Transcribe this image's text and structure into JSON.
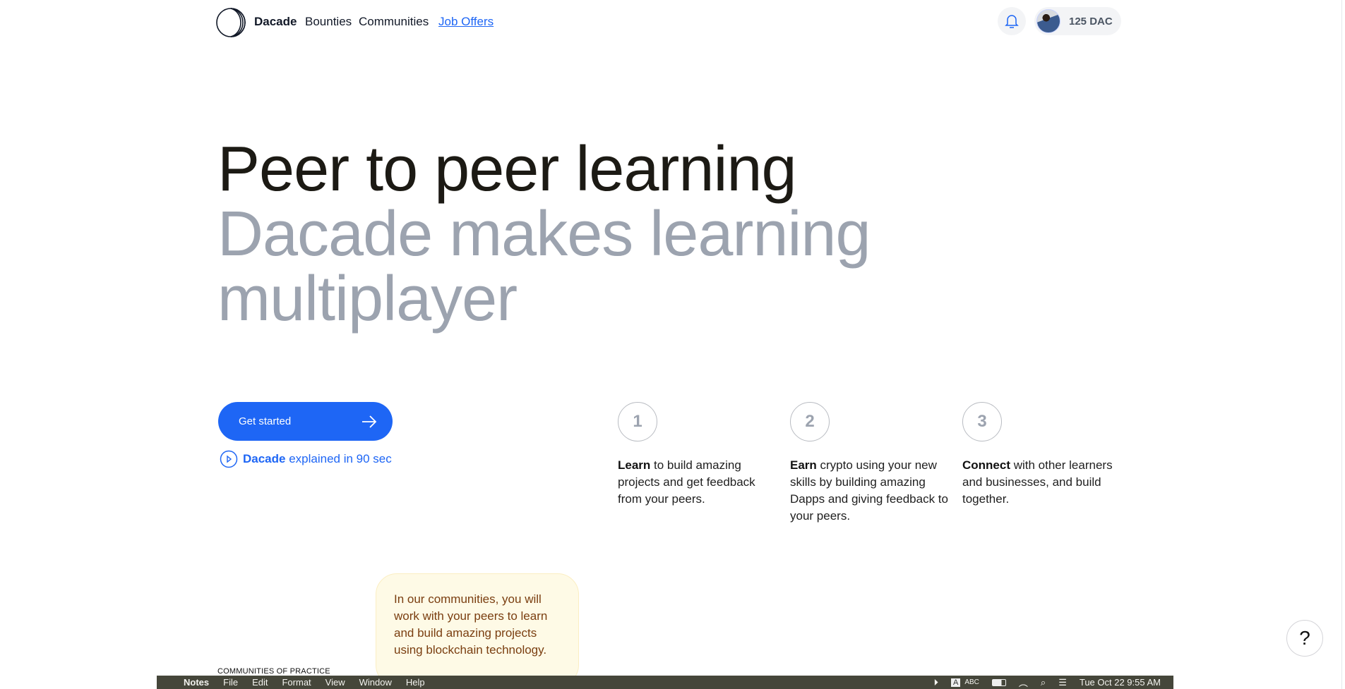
{
  "nav": {
    "brand": "Dacade",
    "links": [
      "Bounties",
      "Communities",
      "Job Offers"
    ],
    "balance": "125 DAC",
    "accent": "#1e66f5"
  },
  "hero": {
    "title": "Peer to peer learning",
    "subtitle_line1": "Dacade makes learning",
    "subtitle_line2": "multiplayer"
  },
  "cta": {
    "label": "Get started",
    "video_brand": "Dacade",
    "video_text": "explained in 90 sec"
  },
  "steps": [
    {
      "number": "1",
      "bold": "Learn",
      "text": " to build amazing projects and get feedback from your peers."
    },
    {
      "number": "2",
      "bold": "Earn",
      "text": " crypto using your new skills by building amazing Dapps and giving feedback to your peers."
    },
    {
      "number": "3",
      "bold": "Connect",
      "text": " with other learners and businesses, and build together."
    }
  ],
  "tooltip": "In our communities, you will work with your peers to learn and build amazing projects using blockchain technology.",
  "section_label": "COMMUNITIES OF PRACTICE",
  "help": "?",
  "menubar": {
    "app": "Notes",
    "items": [
      "File",
      "Edit",
      "Format",
      "View",
      "Window",
      "Help"
    ],
    "input": "ABC",
    "input_badge": "A",
    "datetime": "Tue Oct 22  9:55 AM"
  }
}
